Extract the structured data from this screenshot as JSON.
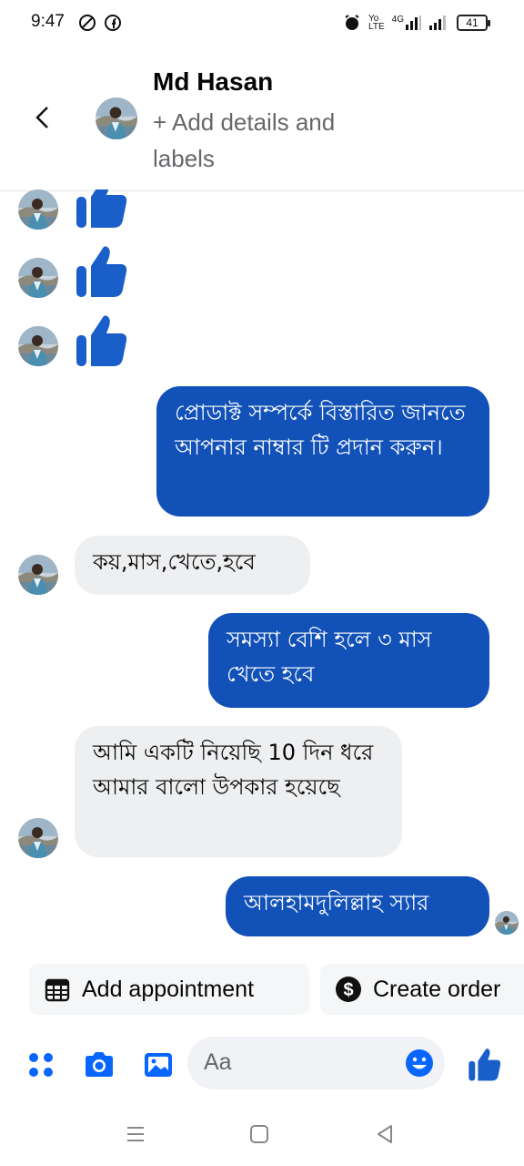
{
  "status_bar": {
    "time": "9:47",
    "volte_top": "Yo",
    "volte_bottom": "LTE",
    "network": "4G",
    "battery": "41"
  },
  "header": {
    "contact_name": "Md Hasan",
    "subtitle": "+ Add details and labels"
  },
  "messages": [
    {
      "id": "m1",
      "direction": "out",
      "text": "প্রোডাক্ট সম্পর্কে বিস্তারিত জানতে আপনার নাম্বার টি প্রদান করুন।"
    },
    {
      "id": "m2",
      "direction": "in",
      "text": "কয়,মাস,খেতে,হবে"
    },
    {
      "id": "m3",
      "direction": "out",
      "text": "সমস্যা বেশি হলে ৩ মাস খেতে হবে"
    },
    {
      "id": "m4",
      "direction": "in",
      "text": "আমি একটি নিয়েছি 10 দিন ধরে আমার বালো উপকার হয়েছে"
    },
    {
      "id": "m5",
      "direction": "out",
      "text": "আলহামদুলিল্লাহ স্যার"
    }
  ],
  "quick_actions": {
    "appointment": "Add appointment",
    "order": "Create order"
  },
  "composer": {
    "placeholder": "Aa"
  },
  "colors": {
    "accent": "#0866ff",
    "outgoing_bubble": "#1151b8",
    "incoming_bubble": "#eeeff1",
    "like_blue": "#1a5fc9"
  },
  "icons": [
    "back-arrow-icon",
    "grid-menu-icon",
    "camera-icon",
    "gallery-icon",
    "emoji-icon",
    "thumbs-up-icon",
    "calendar-icon",
    "dollar-icon"
  ]
}
